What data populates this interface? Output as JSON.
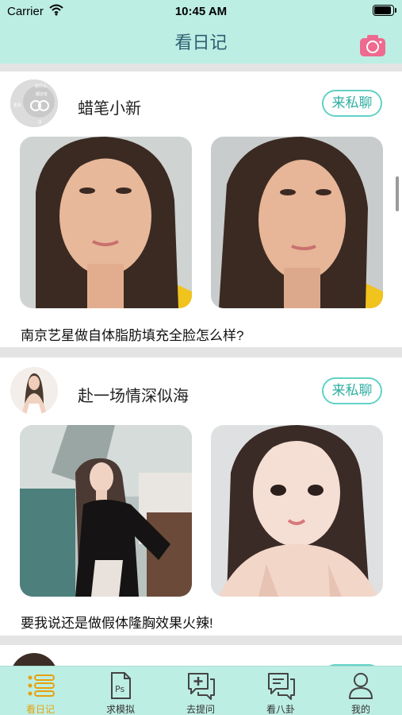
{
  "status_bar": {
    "carrier": "Carrier",
    "time": "10:45 AM"
  },
  "header": {
    "title": "看日记",
    "camera_icon": "camera-icon"
  },
  "posts": [
    {
      "username": "蜡笔小新",
      "chat_label": "来私聊",
      "caption": "南京艺星做自体脂肪填充全脸怎么样?",
      "avatar_texts": [
        "如什么",
        "都还有",
        "更多",
        "0"
      ]
    },
    {
      "username": "赴一场情深似海",
      "chat_label": "来私聊",
      "caption": "要我说还是做假体隆胸效果火辣!"
    }
  ],
  "tabbar": {
    "active_index": 0,
    "items": [
      {
        "label": "看日记",
        "icon": "list-icon"
      },
      {
        "label": "求模拟",
        "icon": "ps-document-icon"
      },
      {
        "label": "去提问",
        "icon": "add-chat-icon"
      },
      {
        "label": "看八卦",
        "icon": "chat-bubble-icon"
      },
      {
        "label": "我的",
        "icon": "person-icon"
      }
    ]
  },
  "colors": {
    "header_bg": "#bdeee3",
    "accent": "#62d2c6",
    "active_tab": "#e6a10f",
    "camera": "#ee6a8f"
  }
}
